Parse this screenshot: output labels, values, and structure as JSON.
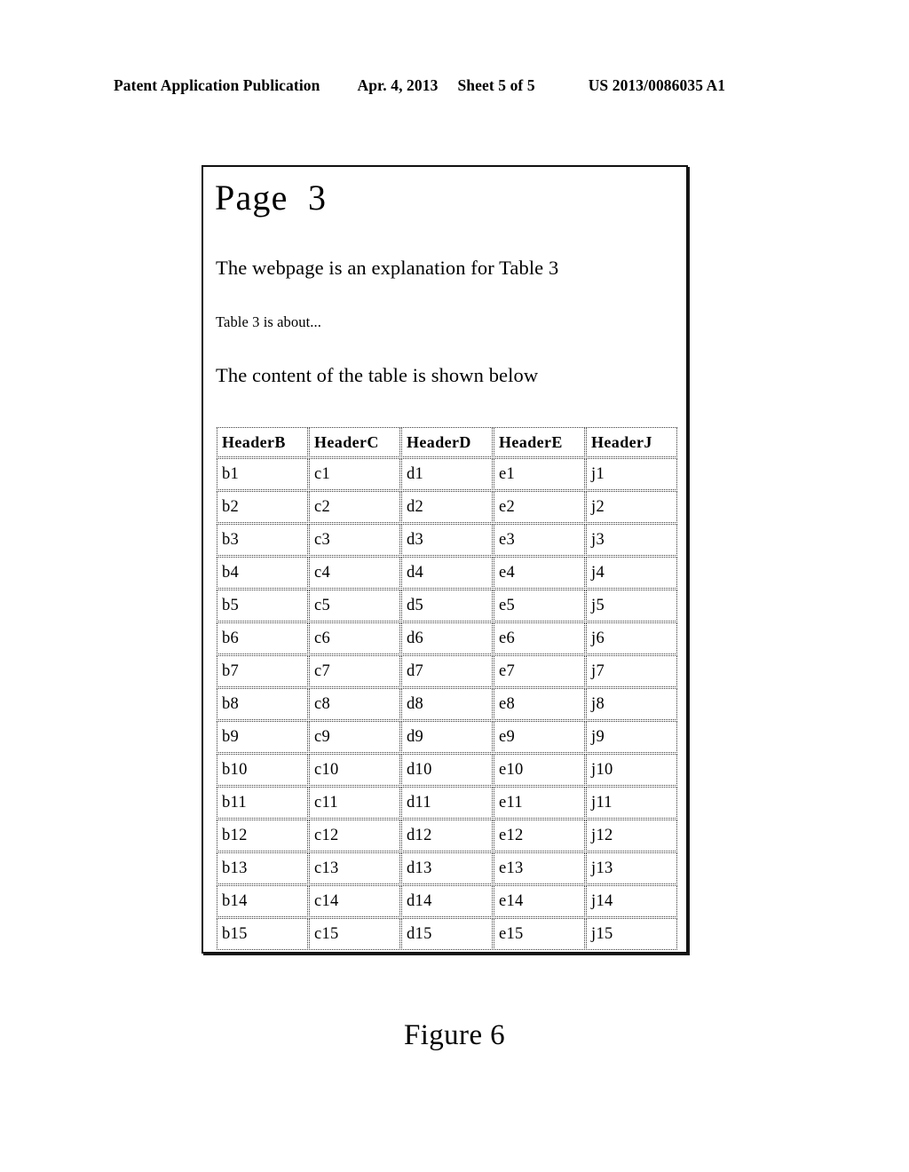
{
  "patent_header": {
    "publication_label": "Patent Application Publication",
    "date": "Apr. 4, 2013",
    "sheet": "Sheet 5 of 5",
    "publication_number": "US 2013/0086035 A1"
  },
  "figure": {
    "caption": "Figure 6",
    "page": {
      "title": "Page  3",
      "paragraph_1": "The webpage is an explanation for Table 3",
      "paragraph_2": "Table 3 is about...",
      "paragraph_3": "The content of the table is shown below"
    },
    "table": {
      "headers": [
        "HeaderB",
        "HeaderC",
        "HeaderD",
        "HeaderE",
        "HeaderJ"
      ],
      "rows": [
        [
          "b1",
          "c1",
          "d1",
          "e1",
          "j1"
        ],
        [
          "b2",
          "c2",
          "d2",
          "e2",
          "j2"
        ],
        [
          "b3",
          "c3",
          "d3",
          "e3",
          "j3"
        ],
        [
          "b4",
          "c4",
          "d4",
          "e4",
          "j4"
        ],
        [
          "b5",
          "c5",
          "d5",
          "e5",
          "j5"
        ],
        [
          "b6",
          "c6",
          "d6",
          "e6",
          "j6"
        ],
        [
          "b7",
          "c7",
          "d7",
          "e7",
          "j7"
        ],
        [
          "b8",
          "c8",
          "d8",
          "e8",
          "j8"
        ],
        [
          "b9",
          "c9",
          "d9",
          "e9",
          "j9"
        ],
        [
          "b10",
          "c10",
          "d10",
          "e10",
          "j10"
        ],
        [
          "b11",
          "c11",
          "d11",
          "e11",
          "j11"
        ],
        [
          "b12",
          "c12",
          "d12",
          "e12",
          "j12"
        ],
        [
          "b13",
          "c13",
          "d13",
          "e13",
          "j13"
        ],
        [
          "b14",
          "c14",
          "d14",
          "e14",
          "j14"
        ],
        [
          "b15",
          "c15",
          "d15",
          "e15",
          "j15"
        ]
      ]
    }
  }
}
